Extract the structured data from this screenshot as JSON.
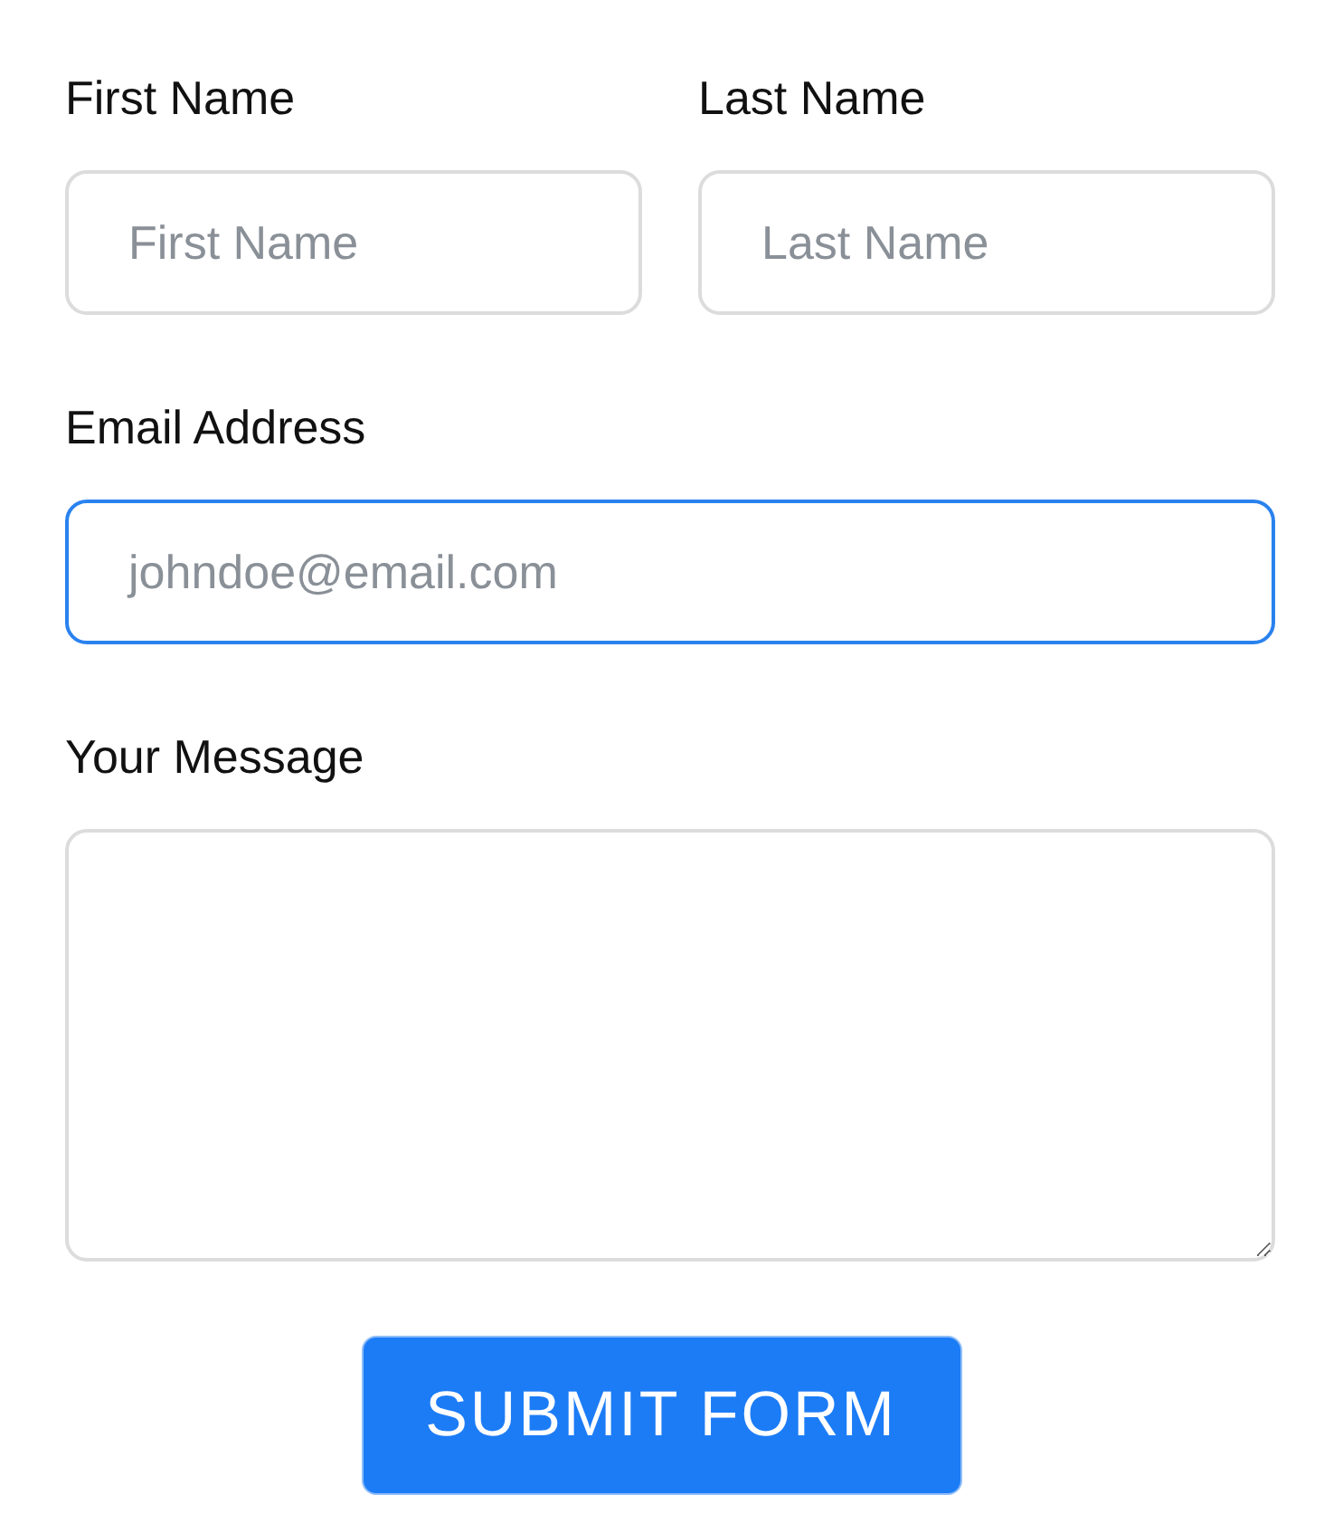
{
  "fields_row": [
    {
      "label": "First Name",
      "placeholder": "First Name",
      "focused": false
    },
    {
      "label": "Last Name",
      "placeholder": "Last Name",
      "focused": false
    }
  ],
  "email": {
    "label": "Email Address",
    "placeholder": "johndoe@email.com",
    "focused": true
  },
  "message": {
    "label": "Your Message",
    "focused": false
  },
  "submit": {
    "label": "SUBMIT FORM"
  }
}
